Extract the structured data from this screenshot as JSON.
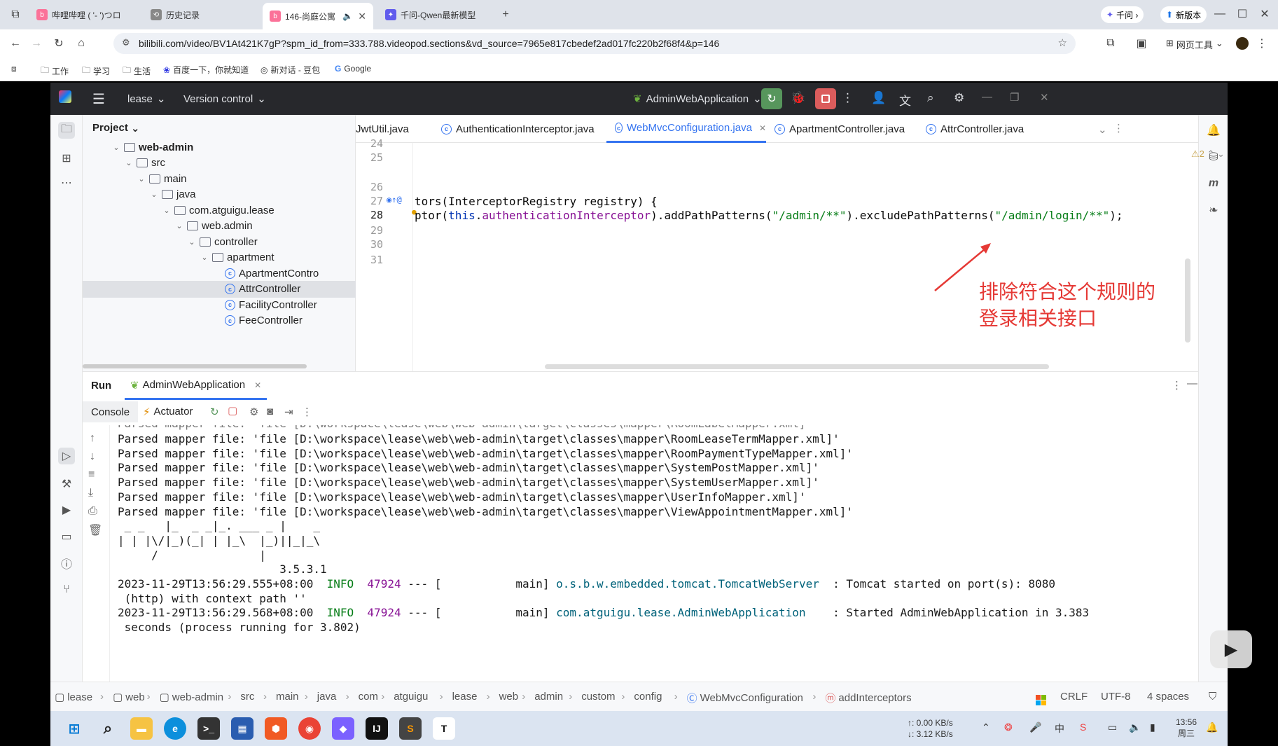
{
  "browser": {
    "tabs": [
      {
        "label": "哔哩哔哩 ( '- ')つロ",
        "color": "#fb7299"
      },
      {
        "label": "历史记录",
        "color": "#666"
      },
      {
        "label": "146-尚庭公寓",
        "color": "#fb7299"
      },
      {
        "label": "千问-Qwen最新模型",
        "color": "#615ced"
      }
    ],
    "new_tab": "+",
    "qianwen_btn": "千问 ›",
    "new_version": "新版本",
    "url": "bilibili.com/video/BV1At421K7gP?spm_id_from=333.788.videopod.sections&vd_source=7965e817cbedef2ad017fc220b2f68f4&p=146",
    "web_tools": "网页工具",
    "bookmarks": [
      "工作",
      "学习",
      "生活",
      "百度一下，你就知道",
      "新对话 - 豆包",
      "Google"
    ]
  },
  "ide": {
    "project_name": "lease",
    "version_control": "Version control",
    "run_config": "AdminWebApplication",
    "project_label": "Project",
    "tree": [
      {
        "label": "web-admin",
        "indent": 0,
        "type": "module",
        "open": true
      },
      {
        "label": "src",
        "indent": 1,
        "type": "folder",
        "open": true
      },
      {
        "label": "main",
        "indent": 2,
        "type": "folder",
        "open": true
      },
      {
        "label": "java",
        "indent": 3,
        "type": "folder",
        "open": true
      },
      {
        "label": "com.atguigu.lease",
        "indent": 4,
        "type": "folder",
        "open": true
      },
      {
        "label": "web.admin",
        "indent": 5,
        "type": "folder",
        "open": true
      },
      {
        "label": "controller",
        "indent": 6,
        "type": "folder",
        "open": true
      },
      {
        "label": "apartment",
        "indent": 7,
        "type": "folder",
        "open": true
      },
      {
        "label": "ApartmentContro",
        "indent": 8,
        "type": "class"
      },
      {
        "label": "AttrController",
        "indent": 8,
        "type": "class",
        "selected": true
      },
      {
        "label": "FacilityController",
        "indent": 8,
        "type": "class"
      },
      {
        "label": "FeeController",
        "indent": 8,
        "type": "class"
      }
    ],
    "editor_tabs": [
      {
        "label": "JwtUtil.java"
      },
      {
        "label": "AuthenticationInterceptor.java"
      },
      {
        "label": "WebMvcConfiguration.java",
        "active": true
      },
      {
        "label": "ApartmentController.java"
      },
      {
        "label": "AttrController.java"
      }
    ],
    "warnings": "⚠2",
    "line_numbers": [
      "24",
      "25",
      "26",
      "27",
      "28",
      "29",
      "30",
      "31"
    ],
    "code_line_27_a": "tors(InterceptorRegistry registry) {",
    "code_line_28": {
      "p1": "ptor(",
      "p2": "this",
      "p3": ".",
      "p4": "authenticationInterceptor",
      "p5": ").addPathPatterns(",
      "p6": "\"/admin/**\"",
      "p7": ").excludePathPatterns(",
      "p8": "\"/admin/login/**\"",
      "p9": ");"
    },
    "annotation": [
      "排除符合这个规则的",
      "登录相关接口"
    ],
    "run": {
      "run_label": "Run",
      "run_tab": "AdminWebApplication",
      "console_tab": "Console",
      "actuator_tab": "Actuator"
    },
    "console_lines": [
      "Parsed mapper file: 'file [D:\\workspace\\lease\\web\\web-admin\\target\\classes\\mapper\\RoomLeaseTermMapper.xml]'",
      "Parsed mapper file: 'file [D:\\workspace\\lease\\web\\web-admin\\target\\classes\\mapper\\RoomPaymentTypeMapper.xml]'",
      "Parsed mapper file: 'file [D:\\workspace\\lease\\web\\web-admin\\target\\classes\\mapper\\SystemPostMapper.xml]'",
      "Parsed mapper file: 'file [D:\\workspace\\lease\\web\\web-admin\\target\\classes\\mapper\\SystemUserMapper.xml]'",
      "Parsed mapper file: 'file [D:\\workspace\\lease\\web\\web-admin\\target\\classes\\mapper\\UserInfoMapper.xml]'",
      "Parsed mapper file: 'file [D:\\workspace\\lease\\web\\web-admin\\target\\classes\\mapper\\ViewAppointmentMapper.xml]'",
      " _ _   |_  _ _|_. ___ _ |    _",
      "| | |\\/|_)(_| | |_\\  |_)||_|_\\",
      "     /               |",
      "                        3.5.3.1"
    ],
    "log1": {
      "ts": "2023-11-29T13:56:29.555+08:00",
      "level": "INFO",
      "pid": "47924",
      "mid": " --- [           main] ",
      "logger": "o.s.b.w.embedded.tomcat.TomcatWebServer",
      "msg": "  : Tomcat started on port(s): 8080",
      "cont": " (http) with context path ''"
    },
    "log2": {
      "ts": "2023-11-29T13:56:29.568+08:00",
      "level": "INFO",
      "pid": "47924",
      "mid": " --- [           main] ",
      "logger": "com.atguigu.lease.AdminWebApplication",
      "msg": "    : Started AdminWebApplication in 3.383",
      "cont": " seconds (process running for 3.802)"
    },
    "breadcrumb": [
      "lease",
      "web",
      "web-admin",
      "src",
      "main",
      "java",
      "com",
      "atguigu",
      "lease",
      "web",
      "admin",
      "custom",
      "config",
      "WebMvcConfiguration",
      "addInterceptors"
    ],
    "status": {
      "line_sep": "CRLF",
      "encoding": "UTF-8",
      "indent": "4 spaces"
    }
  },
  "taskbar": {
    "net_up": "↑: 0.00 KB/s",
    "net_down": "↓: 3.12 KB/s",
    "time": "13:56",
    "day": "周三"
  }
}
